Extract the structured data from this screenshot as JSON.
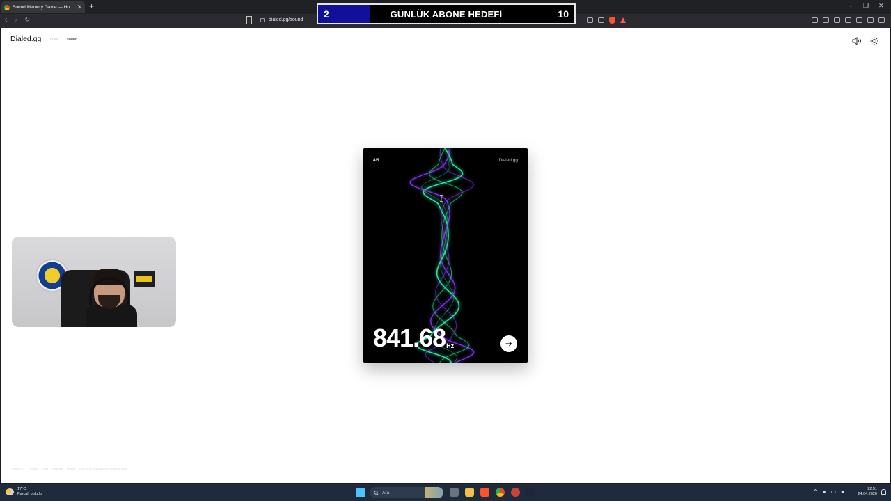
{
  "browser": {
    "tab_title": "Sound Memory Game — Ho...",
    "tab_close": "✕",
    "new_tab": "+",
    "url": "dialed.gg/sound",
    "window_controls": [
      "–",
      "❐",
      "✕"
    ]
  },
  "overlay": {
    "current": "2",
    "label": "GÜNLÜK ABONE HEDEFİ",
    "goal": "10",
    "fill_color": "#10109a",
    "progress_fraction": 0.2
  },
  "site": {
    "logo": "Dialed.gg",
    "nav": [
      "color",
      "sound"
    ],
    "active_nav": "sound",
    "icons": [
      "speaker-icon",
      "sun-icon"
    ]
  },
  "card": {
    "progress": "4/5",
    "brand": "Dialed.gg",
    "frequency": "841.68",
    "unit": "Hz",
    "wave_colors": [
      "#2ee6a6",
      "#8a3cff"
    ]
  },
  "footer": {
    "items": [
      "Sound 1.0",
      "Privacy",
      "Labs",
      "Sources",
      "Stories",
      "Do it to all to sound me person to kinly"
    ]
  },
  "taskbar": {
    "weather_temp": "17°C",
    "weather_desc": "Parçalı bulutlu",
    "search_placeholder": "Ara",
    "time": "22:51",
    "date": "24.04.2026"
  }
}
